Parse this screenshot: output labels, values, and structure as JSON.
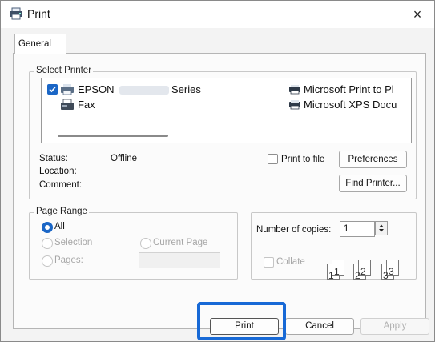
{
  "window": {
    "title": "Print",
    "close_glyph": "×",
    "tab_general": "General"
  },
  "select_printer": {
    "legend": "Select Printer",
    "printers": [
      {
        "name": "EPSON",
        "suffix": "Series",
        "selected": true,
        "icon": "printer-icon"
      },
      {
        "name": "Fax",
        "icon": "fax-icon"
      },
      {
        "name": "Microsoft Print to Pl",
        "icon": "printer-icon"
      },
      {
        "name": "Microsoft XPS Docu",
        "icon": "printer-icon"
      }
    ],
    "status_label": "Status:",
    "status_value": "Offline",
    "location_label": "Location:",
    "comment_label": "Comment:",
    "print_to_file": "Print to file",
    "preferences": "Preferences",
    "find_printer": "Find Printer..."
  },
  "page_range": {
    "legend": "Page Range",
    "all": "All",
    "selection": "Selection",
    "current_page": "Current Page",
    "pages": "Pages:"
  },
  "copies": {
    "label": "Number of copies:",
    "value": "1",
    "collate": "Collate",
    "collate_pages": [
      "1",
      "1",
      "2",
      "2",
      "3",
      "3"
    ]
  },
  "actions": {
    "print": "Print",
    "cancel": "Cancel",
    "apply": "Apply"
  },
  "colors": {
    "accent": "#1a66c6",
    "highlight": "#1769d6"
  }
}
